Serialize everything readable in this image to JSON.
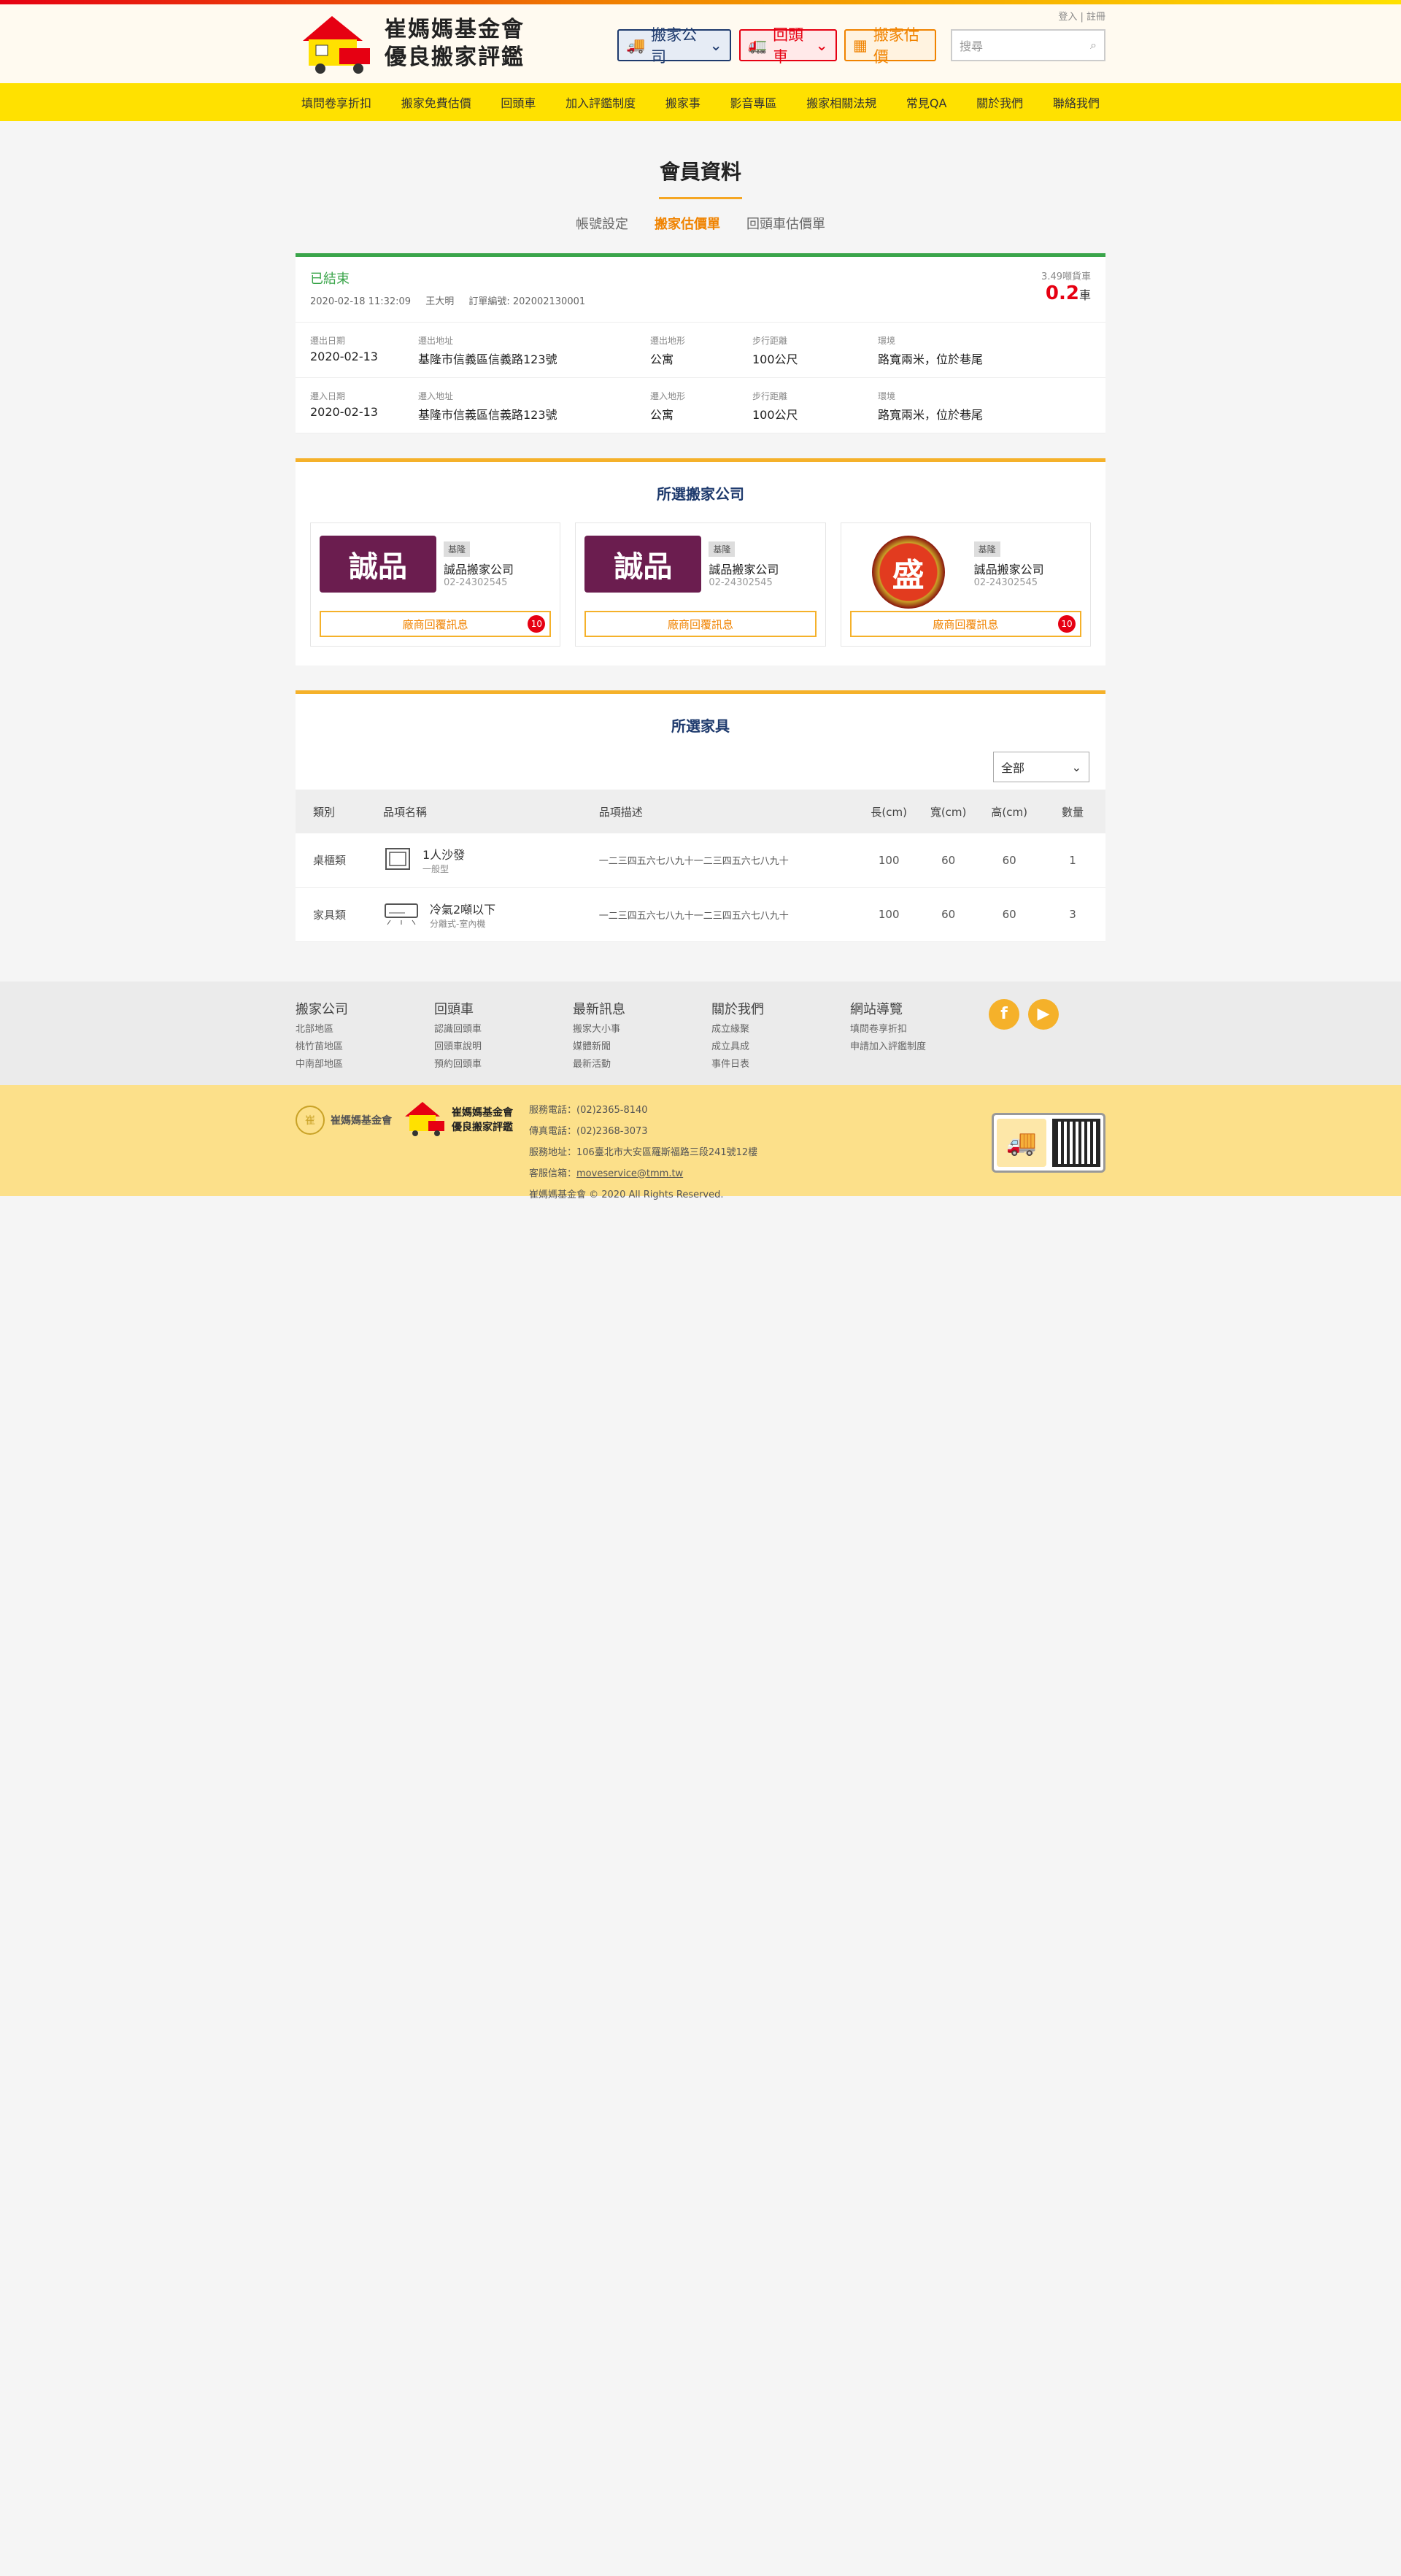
{
  "header": {
    "logo_line1": "崔媽媽基金會",
    "logo_line2": "優良搬家評鑑",
    "login": "登入",
    "register": "註冊",
    "btn_company": "搬家公司",
    "btn_return_truck": "回頭車",
    "btn_estimate": "搬家估價",
    "search_placeholder": "搜尋"
  },
  "nav": [
    "填問卷享折扣",
    "搬家免費估價",
    "回頭車",
    "加入評鑑制度",
    "搬家事",
    "影音專區",
    "搬家相關法規",
    "常見QA",
    "關於我們",
    "聯絡我們"
  ],
  "page": {
    "title": "會員資料",
    "tabs": [
      "帳號設定",
      "搬家估價單",
      "回頭車估價單"
    ]
  },
  "order": {
    "status": "已結束",
    "datetime": "2020-02-18 11:32:09",
    "name": "王大明",
    "order_no": "訂單編號: 202002130001",
    "cubic": "3.49噸貨車",
    "trucks": "0.2",
    "truck_unit": "車",
    "rows": [
      {
        "date_label": "遷出日期",
        "date": "2020-02-13",
        "addr_label": "遷出地址",
        "addr": "基隆市信義區信義路123號",
        "shape_label": "遷出地形",
        "shape": "公寓",
        "dist_label": "步行距離",
        "dist": "100公尺",
        "env_label": "環境",
        "env": "路寬兩米，位於巷尾"
      },
      {
        "date_label": "遷入日期",
        "date": "2020-02-13",
        "addr_label": "遷入地址",
        "addr": "基隆市信義區信義路123號",
        "shape_label": "遷入地形",
        "shape": "公寓",
        "dist_label": "步行距離",
        "dist": "100公尺",
        "env_label": "環境",
        "env": "路寬兩米，位於巷尾"
      }
    ]
  },
  "companies": {
    "title": "所選搬家公司",
    "items": [
      {
        "tag": "基隆",
        "name": "誠品搬家公司",
        "tel": "02-24302545",
        "msg": "廠商回覆訊息",
        "badge": "10",
        "logo": "誠品"
      },
      {
        "tag": "基隆",
        "name": "誠品搬家公司",
        "tel": "02-24302545",
        "msg": "廠商回覆訊息",
        "badge": "",
        "logo": "誠品"
      },
      {
        "tag": "基隆",
        "name": "誠品搬家公司",
        "tel": "02-24302545",
        "msg": "廠商回覆訊息",
        "badge": "10",
        "logo": "盛"
      }
    ]
  },
  "furniture": {
    "title": "所選家具",
    "filter": "全部",
    "headers": [
      "類別",
      "品項名稱",
      "品項描述",
      "長(cm)",
      "寬(cm)",
      "高(cm)",
      "數量"
    ],
    "rows": [
      {
        "cat": "桌櫃類",
        "name": "1人沙發",
        "sub": "一般型",
        "desc": "一二三四五六七八九十一二三四五六七八九十",
        "l": "100",
        "w": "60",
        "h": "60",
        "qty": "1"
      },
      {
        "cat": "家具類",
        "name": "冷氣2噸以下",
        "sub": "分離式-室內機",
        "desc": "一二三四五六七八九十一二三四五六七八九十",
        "l": "100",
        "w": "60",
        "h": "60",
        "qty": "3"
      }
    ]
  },
  "footer": {
    "cols": [
      {
        "title": "搬家公司",
        "links": [
          "北部地區",
          "桃竹苗地區",
          "中南部地區"
        ]
      },
      {
        "title": "回頭車",
        "links": [
          "認識回頭車",
          "回頭車說明",
          "預約回頭車"
        ]
      },
      {
        "title": "最新訊息",
        "links": [
          "搬家大小事",
          "媒體新聞",
          "最新活動"
        ]
      },
      {
        "title": "關於我們",
        "links": [
          "成立緣聚",
          "成立具成",
          "事件日表"
        ]
      },
      {
        "title": "網站導覽",
        "links": [
          "填問卷享折扣",
          "申請加入評鑑制度"
        ]
      }
    ],
    "logo1": "崔媽媽基金會",
    "logo2_l1": "崔媽媽基金會",
    "logo2_l2": "優良搬家評鑑",
    "phone": "服務電話：(02)2365-8140",
    "fax": "傳真電話：(02)2368-3073",
    "address": "服務地址：106臺北市大安區羅斯福路三段241號12樓",
    "email_label": "客服信箱：",
    "email": "moveservice@tmm.tw",
    "copyright": "崔媽媽基金會 © 2020 All Rights Reserved.",
    "colors": {
      "facebook": "#f5b12a",
      "youtube": "#f5b12a"
    }
  }
}
